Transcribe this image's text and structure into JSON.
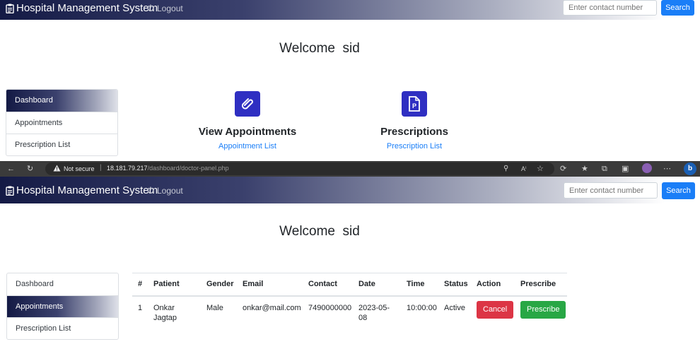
{
  "top_panel": {
    "brand": "Hospital Management System",
    "logout_label": "Logout",
    "search_placeholder": "Enter contact number",
    "search_button": "Search",
    "welcome": "Welcome  sid",
    "sidebar": [
      "Dashboard",
      "Appointments",
      "Prescription List"
    ],
    "active_item": "Dashboard",
    "features": [
      {
        "title": "View Appointments",
        "link": "Appointment List",
        "icon": "paperclip-icon"
      },
      {
        "title": "Prescriptions",
        "link": "Prescription List",
        "icon": "prescription-file-icon"
      }
    ]
  },
  "browser": {
    "security_label": "Not secure",
    "url_host": "18.181.79.217",
    "url_path": "/dashboard/doctor-panel.php"
  },
  "bottom_panel": {
    "brand": "Hospital Management System",
    "logout_label": "Logout",
    "search_placeholder": "Enter contact number",
    "search_button": "Search",
    "welcome": "Welcome  sid",
    "sidebar": [
      "Dashboard",
      "Appointments",
      "Prescription List"
    ],
    "active_item": "Appointments",
    "table": {
      "headers": [
        "#",
        "Patient",
        "Gender",
        "Email",
        "Contact",
        "Date",
        "Time",
        "Status",
        "Action",
        "Prescribe"
      ],
      "rows": [
        {
          "num": "1",
          "patient_line1": "Onkar",
          "patient_line2": "Jagtap",
          "gender": "Male",
          "email": "onkar@mail.com",
          "contact": "7490000000",
          "date_line1": "2023-05-",
          "date_line2": "08",
          "time": "10:00:00",
          "status": "Active",
          "action": "Cancel",
          "prescribe": "Prescribe"
        }
      ]
    }
  },
  "colors": {
    "navbar_dark": "#141a45",
    "primary": "#1a7ef7",
    "icon_tile": "#2f2fc2",
    "danger": "#dc3545",
    "success": "#28a745"
  }
}
